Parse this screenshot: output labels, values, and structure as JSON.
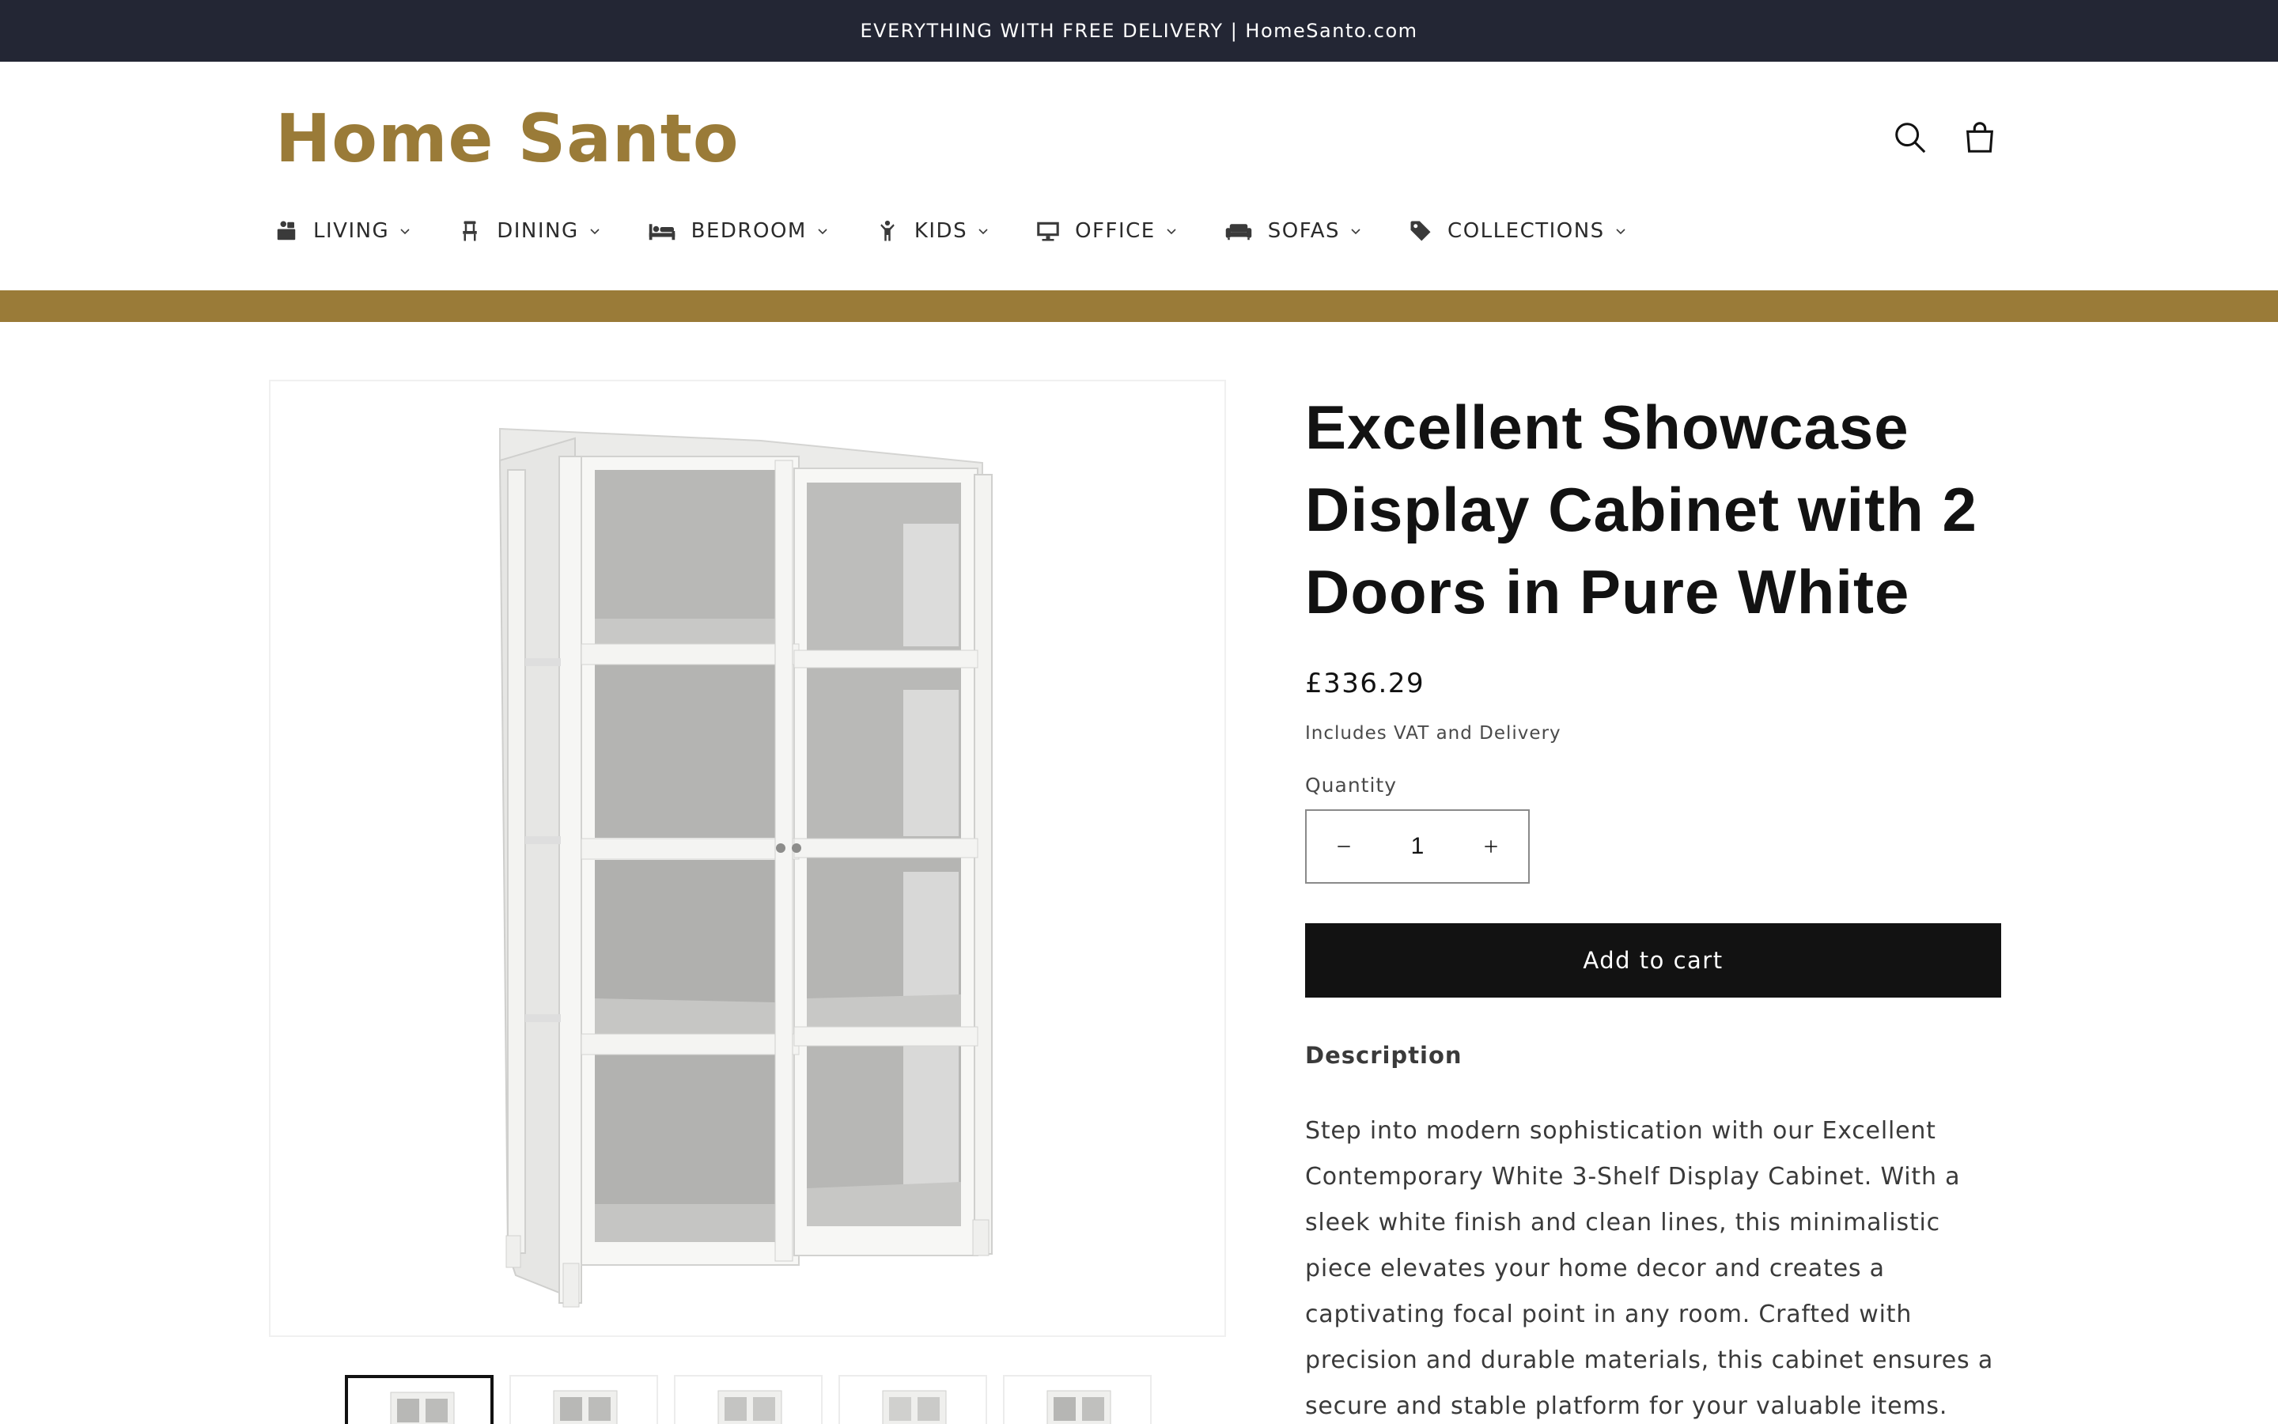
{
  "announcement": {
    "text": "EVERYTHING WITH FREE DELIVERY | HomeSanto.com"
  },
  "brand": {
    "logo_text": "Home Santo",
    "color": "#9a7b38"
  },
  "header": {
    "search_icon": "search-icon",
    "cart_icon": "cart-icon"
  },
  "nav": {
    "items": [
      {
        "label": "LIVING",
        "icon": "couch-box-icon"
      },
      {
        "label": "DINING",
        "icon": "chair-icon"
      },
      {
        "label": "BEDROOM",
        "icon": "bed-icon"
      },
      {
        "label": "KIDS",
        "icon": "child-icon"
      },
      {
        "label": "OFFICE",
        "icon": "monitor-icon"
      },
      {
        "label": "SOFAS",
        "icon": "sofa-icon"
      },
      {
        "label": "COLLECTIONS",
        "icon": "tag-icon"
      }
    ]
  },
  "product": {
    "title": "Excellent Showcase Display Cabinet with 2 Doors in Pure White",
    "price": "£336.29",
    "tax_note": "Includes VAT and Delivery",
    "quantity_label": "Quantity",
    "quantity_value": "1",
    "add_to_cart_label": "Add to cart",
    "description_heading": "Description",
    "description_text": "Step into modern sophistication with our Excellent Contemporary White 3-Shelf Display Cabinet. With a sleek white finish and clean lines, this minimalistic piece elevates your home decor and creates a captivating focal point in any room. Crafted with precision and durable materials, this cabinet ensures a secure and stable platform for your valuable items. The three open shelves provide a unique way"
  },
  "colors": {
    "announcement_bg": "#232634",
    "accent": "#9a7b38",
    "button_bg": "#121212"
  }
}
